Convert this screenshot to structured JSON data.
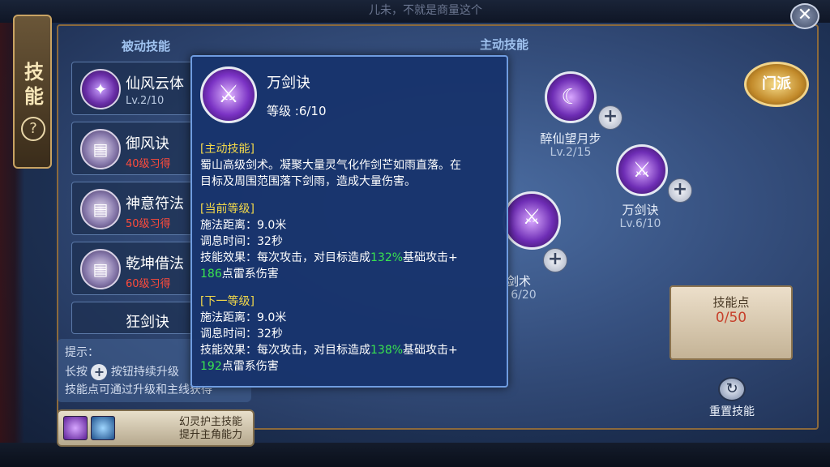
{
  "banner": {
    "text": "儿未，不就是商量这个"
  },
  "close": {
    "label": "✕"
  },
  "side_tab": {
    "label": "技能",
    "help": "?"
  },
  "sections": {
    "passive": "被动技能",
    "active": "主动技能"
  },
  "passive_skills": [
    {
      "name": "仙风云体",
      "sub": "Lv.2/10",
      "sub_type": "level",
      "icon": "wind-swirl-icon"
    },
    {
      "name": "御风诀",
      "sub": "40级习得",
      "sub_type": "req",
      "icon": "scroll-icon"
    },
    {
      "name": "神意符法",
      "sub": "50级习得",
      "sub_type": "req",
      "icon": "scroll-icon"
    },
    {
      "name": "乾坤借法",
      "sub": "60级习得",
      "sub_type": "req",
      "icon": "scroll-icon"
    },
    {
      "name": "狂剑诀",
      "sub": "",
      "sub_type": "req",
      "icon": "scroll-icon"
    }
  ],
  "hint": {
    "title": "提示：",
    "line1_prefix": "长按",
    "line1_suffix": "按钮持续升级",
    "line2": "技能点可通过升级和主线获得"
  },
  "spirit": {
    "text_line1": "幻灵护主技能",
    "text_line2": "提升主角能力"
  },
  "active_skills": [
    {
      "name": "醉仙望月步",
      "level": "Lv.2/15",
      "icon": "moon-step-icon"
    },
    {
      "name": "万剑诀",
      "level": "Lv.6/10",
      "icon": "sword-rain-icon"
    },
    {
      "name": "剑术",
      "level": "6/20",
      "icon": "sword-slash-icon"
    }
  ],
  "sect": {
    "label": "门派"
  },
  "skill_points": {
    "label": "技能点",
    "value": "0/50"
  },
  "reset": {
    "label": "重置技能"
  },
  "tooltip": {
    "name": "万剑诀",
    "level": "等级 :6/10",
    "sec_active": "[主动技能]",
    "desc1": "蜀山高级剑术。凝聚大量灵气化作剑芒如雨直落。在",
    "desc2": "目标及周围范围落下剑雨，造成大量伤害。",
    "sec_current": "[当前等级]",
    "cur_range": "施法距离：9.0米",
    "cur_cd": "调息时间：32秒",
    "cur_effect_a": "技能效果：每次攻击，对目标造成",
    "cur_pct": "132%",
    "cur_effect_b": "基础攻击+",
    "cur_dmg": "186",
    "cur_effect_c": "点雷系伤害",
    "sec_next": "[下一等级]",
    "next_range": "施法距离：9.0米",
    "next_cd": "调息时间：32秒",
    "next_effect_a": "技能效果：每次攻击，对目标造成",
    "next_pct": "138%",
    "next_effect_b": "基础攻击+",
    "next_dmg": "192",
    "next_effect_c": "点雷系伤害"
  }
}
